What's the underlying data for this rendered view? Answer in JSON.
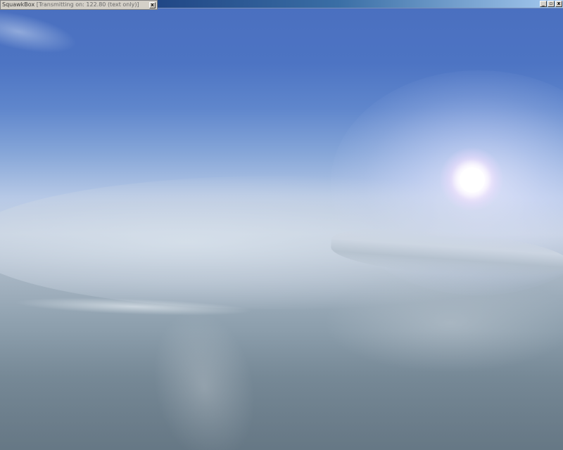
{
  "squawkbox": {
    "app_name": "SquawkBox",
    "status": "[Transmitting on: 122.80 (text only)]",
    "close_glyph": "x"
  },
  "window_controls": {
    "minimize_glyph": "_",
    "restore_glyph": "▫",
    "close_glyph": "x"
  },
  "scene": {
    "description_icon": "sun-icon"
  },
  "colors": {
    "sky_top": "#4a6fbf",
    "horizon": "#c8d3e2",
    "ground": "#6f8290",
    "titlebar": "#d4d0c8"
  }
}
